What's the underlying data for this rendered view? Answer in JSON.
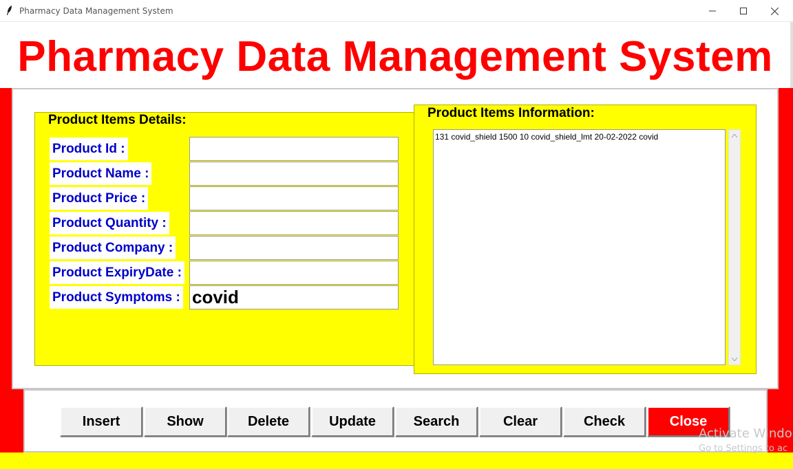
{
  "window": {
    "title": "Pharmacy Data Management System",
    "minimize_glyph": "—",
    "maximize_glyph": "☐",
    "close_glyph": "✕"
  },
  "app_title": "Pharmacy Data Management System",
  "details": {
    "title": "Product Items Details:",
    "fields": [
      {
        "label": "Product Id :",
        "value": ""
      },
      {
        "label": "Product Name :",
        "value": ""
      },
      {
        "label": "Product Price :",
        "value": ""
      },
      {
        "label": "Product Quantity :",
        "value": ""
      },
      {
        "label": "Product Company :",
        "value": ""
      },
      {
        "label": "Product ExpiryDate :",
        "value": ""
      },
      {
        "label": "Product Symptoms :",
        "value": "covid"
      }
    ]
  },
  "info": {
    "title": "Product Items Information:",
    "items": [
      "131 covid_shield 1500 10 covid_shield_lmt 20-02-2022 covid"
    ]
  },
  "buttons": {
    "insert": "Insert",
    "show": "Show",
    "delete": "Delete",
    "update": "Update",
    "search": "Search",
    "clear": "Clear",
    "check": "Check",
    "close": "Close"
  },
  "watermark": {
    "line1": "Activate Windo",
    "line2": "Go to Settings to ac"
  },
  "colors": {
    "title_red": "#ff0000",
    "frame_yellow": "#ffff00",
    "label_blue": "#0000cc",
    "close_button": "#ff0000"
  },
  "icons": {
    "app": "feather-icon",
    "scroll_up": "arrow-up-icon",
    "scroll_down": "arrow-down-icon"
  }
}
